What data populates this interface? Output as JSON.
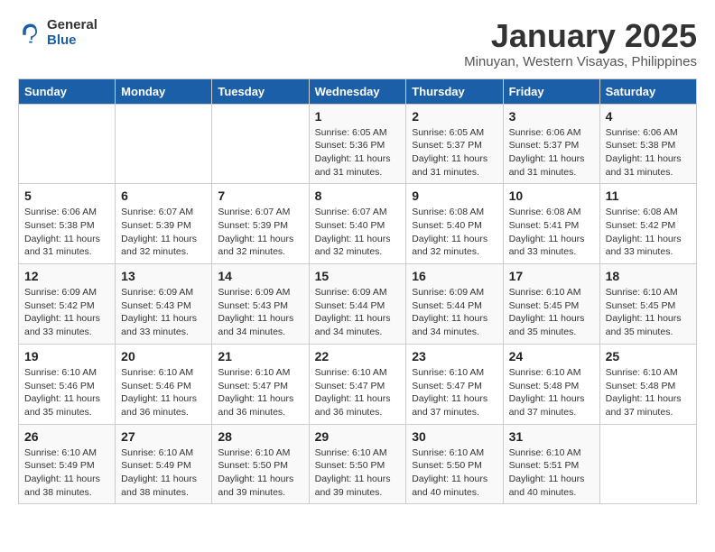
{
  "logo": {
    "general": "General",
    "blue": "Blue"
  },
  "header": {
    "title": "January 2025",
    "subtitle": "Minuyan, Western Visayas, Philippines"
  },
  "weekdays": [
    "Sunday",
    "Monday",
    "Tuesday",
    "Wednesday",
    "Thursday",
    "Friday",
    "Saturday"
  ],
  "weeks": [
    [
      {
        "day": "",
        "sunrise": "",
        "sunset": "",
        "daylight": ""
      },
      {
        "day": "",
        "sunrise": "",
        "sunset": "",
        "daylight": ""
      },
      {
        "day": "",
        "sunrise": "",
        "sunset": "",
        "daylight": ""
      },
      {
        "day": "1",
        "sunrise": "Sunrise: 6:05 AM",
        "sunset": "Sunset: 5:36 PM",
        "daylight": "Daylight: 11 hours and 31 minutes."
      },
      {
        "day": "2",
        "sunrise": "Sunrise: 6:05 AM",
        "sunset": "Sunset: 5:37 PM",
        "daylight": "Daylight: 11 hours and 31 minutes."
      },
      {
        "day": "3",
        "sunrise": "Sunrise: 6:06 AM",
        "sunset": "Sunset: 5:37 PM",
        "daylight": "Daylight: 11 hours and 31 minutes."
      },
      {
        "day": "4",
        "sunrise": "Sunrise: 6:06 AM",
        "sunset": "Sunset: 5:38 PM",
        "daylight": "Daylight: 11 hours and 31 minutes."
      }
    ],
    [
      {
        "day": "5",
        "sunrise": "Sunrise: 6:06 AM",
        "sunset": "Sunset: 5:38 PM",
        "daylight": "Daylight: 11 hours and 31 minutes."
      },
      {
        "day": "6",
        "sunrise": "Sunrise: 6:07 AM",
        "sunset": "Sunset: 5:39 PM",
        "daylight": "Daylight: 11 hours and 32 minutes."
      },
      {
        "day": "7",
        "sunrise": "Sunrise: 6:07 AM",
        "sunset": "Sunset: 5:39 PM",
        "daylight": "Daylight: 11 hours and 32 minutes."
      },
      {
        "day": "8",
        "sunrise": "Sunrise: 6:07 AM",
        "sunset": "Sunset: 5:40 PM",
        "daylight": "Daylight: 11 hours and 32 minutes."
      },
      {
        "day": "9",
        "sunrise": "Sunrise: 6:08 AM",
        "sunset": "Sunset: 5:40 PM",
        "daylight": "Daylight: 11 hours and 32 minutes."
      },
      {
        "day": "10",
        "sunrise": "Sunrise: 6:08 AM",
        "sunset": "Sunset: 5:41 PM",
        "daylight": "Daylight: 11 hours and 33 minutes."
      },
      {
        "day": "11",
        "sunrise": "Sunrise: 6:08 AM",
        "sunset": "Sunset: 5:42 PM",
        "daylight": "Daylight: 11 hours and 33 minutes."
      }
    ],
    [
      {
        "day": "12",
        "sunrise": "Sunrise: 6:09 AM",
        "sunset": "Sunset: 5:42 PM",
        "daylight": "Daylight: 11 hours and 33 minutes."
      },
      {
        "day": "13",
        "sunrise": "Sunrise: 6:09 AM",
        "sunset": "Sunset: 5:43 PM",
        "daylight": "Daylight: 11 hours and 33 minutes."
      },
      {
        "day": "14",
        "sunrise": "Sunrise: 6:09 AM",
        "sunset": "Sunset: 5:43 PM",
        "daylight": "Daylight: 11 hours and 34 minutes."
      },
      {
        "day": "15",
        "sunrise": "Sunrise: 6:09 AM",
        "sunset": "Sunset: 5:44 PM",
        "daylight": "Daylight: 11 hours and 34 minutes."
      },
      {
        "day": "16",
        "sunrise": "Sunrise: 6:09 AM",
        "sunset": "Sunset: 5:44 PM",
        "daylight": "Daylight: 11 hours and 34 minutes."
      },
      {
        "day": "17",
        "sunrise": "Sunrise: 6:10 AM",
        "sunset": "Sunset: 5:45 PM",
        "daylight": "Daylight: 11 hours and 35 minutes."
      },
      {
        "day": "18",
        "sunrise": "Sunrise: 6:10 AM",
        "sunset": "Sunset: 5:45 PM",
        "daylight": "Daylight: 11 hours and 35 minutes."
      }
    ],
    [
      {
        "day": "19",
        "sunrise": "Sunrise: 6:10 AM",
        "sunset": "Sunset: 5:46 PM",
        "daylight": "Daylight: 11 hours and 35 minutes."
      },
      {
        "day": "20",
        "sunrise": "Sunrise: 6:10 AM",
        "sunset": "Sunset: 5:46 PM",
        "daylight": "Daylight: 11 hours and 36 minutes."
      },
      {
        "day": "21",
        "sunrise": "Sunrise: 6:10 AM",
        "sunset": "Sunset: 5:47 PM",
        "daylight": "Daylight: 11 hours and 36 minutes."
      },
      {
        "day": "22",
        "sunrise": "Sunrise: 6:10 AM",
        "sunset": "Sunset: 5:47 PM",
        "daylight": "Daylight: 11 hours and 36 minutes."
      },
      {
        "day": "23",
        "sunrise": "Sunrise: 6:10 AM",
        "sunset": "Sunset: 5:47 PM",
        "daylight": "Daylight: 11 hours and 37 minutes."
      },
      {
        "day": "24",
        "sunrise": "Sunrise: 6:10 AM",
        "sunset": "Sunset: 5:48 PM",
        "daylight": "Daylight: 11 hours and 37 minutes."
      },
      {
        "day": "25",
        "sunrise": "Sunrise: 6:10 AM",
        "sunset": "Sunset: 5:48 PM",
        "daylight": "Daylight: 11 hours and 37 minutes."
      }
    ],
    [
      {
        "day": "26",
        "sunrise": "Sunrise: 6:10 AM",
        "sunset": "Sunset: 5:49 PM",
        "daylight": "Daylight: 11 hours and 38 minutes."
      },
      {
        "day": "27",
        "sunrise": "Sunrise: 6:10 AM",
        "sunset": "Sunset: 5:49 PM",
        "daylight": "Daylight: 11 hours and 38 minutes."
      },
      {
        "day": "28",
        "sunrise": "Sunrise: 6:10 AM",
        "sunset": "Sunset: 5:50 PM",
        "daylight": "Daylight: 11 hours and 39 minutes."
      },
      {
        "day": "29",
        "sunrise": "Sunrise: 6:10 AM",
        "sunset": "Sunset: 5:50 PM",
        "daylight": "Daylight: 11 hours and 39 minutes."
      },
      {
        "day": "30",
        "sunrise": "Sunrise: 6:10 AM",
        "sunset": "Sunset: 5:50 PM",
        "daylight": "Daylight: 11 hours and 40 minutes."
      },
      {
        "day": "31",
        "sunrise": "Sunrise: 6:10 AM",
        "sunset": "Sunset: 5:51 PM",
        "daylight": "Daylight: 11 hours and 40 minutes."
      },
      {
        "day": "",
        "sunrise": "",
        "sunset": "",
        "daylight": ""
      }
    ]
  ]
}
